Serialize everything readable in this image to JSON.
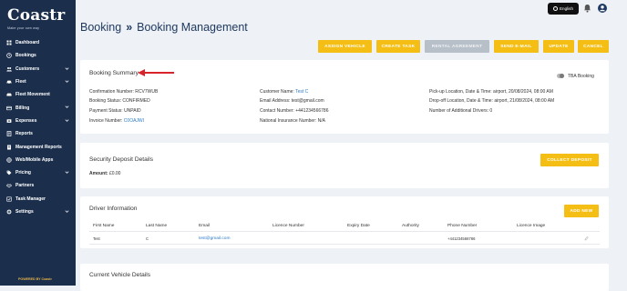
{
  "brand": {
    "name": "Coastr",
    "tagline": "Make your own way",
    "powered": "POWERED BY Coastr"
  },
  "sidebar": {
    "items": [
      {
        "label": "Dashboard",
        "icon": "dashboard-icon",
        "has_children": false
      },
      {
        "label": "Bookings",
        "icon": "bookings-icon",
        "has_children": false
      },
      {
        "label": "Customers",
        "icon": "customers-icon",
        "has_children": true
      },
      {
        "label": "Fleet",
        "icon": "car-icon",
        "has_children": true
      },
      {
        "label": "Fleet Movement",
        "icon": "fleet-movement-icon",
        "has_children": false
      },
      {
        "label": "Billing",
        "icon": "billing-icon",
        "has_children": true
      },
      {
        "label": "Expenses",
        "icon": "expenses-icon",
        "has_children": true
      },
      {
        "label": "Reports",
        "icon": "reports-icon",
        "has_children": false
      },
      {
        "label": "Management Reports",
        "icon": "management-reports-icon",
        "has_children": false
      },
      {
        "label": "Web/Mobile Apps",
        "icon": "apps-icon",
        "has_children": false
      },
      {
        "label": "Pricing",
        "icon": "pricing-icon",
        "has_children": true
      },
      {
        "label": "Partners",
        "icon": "partners-icon",
        "has_children": false
      },
      {
        "label": "Task Manager",
        "icon": "task-manager-icon",
        "has_children": false
      },
      {
        "label": "Settings",
        "icon": "settings-icon",
        "has_children": true
      }
    ]
  },
  "topbar": {
    "language": "English"
  },
  "header": {
    "crumb1": "Booking",
    "separator": "»",
    "crumb2": "Booking Management"
  },
  "actions": {
    "assign_vehicle": "ASSIGN VEHICLE",
    "create_task": "CREATE TASK",
    "rental_agreement": "RENTAL AGREEMENT",
    "send_email": "SEND E-MAIL",
    "update": "UPDATE",
    "cancel": "CANCEL"
  },
  "summary": {
    "title": "Booking Summary",
    "tba_label": "TBA Booking",
    "confirmation_label": "Confirmation Number:",
    "confirmation_value": "RCV7WUB",
    "status_label": "Booking Status:",
    "status_value": "CONFIRMED",
    "payment_label": "Payment Status:",
    "payment_value": "UNPAID",
    "invoice_label": "Invoice Number:",
    "invoice_value": "C0OAJWI",
    "customer_name_label": "Customer Name:",
    "customer_name_value": "Test C",
    "email_label": "Email Address:",
    "email_value": "test@gmail.com",
    "contact_label": "Contact Number:",
    "contact_value": "+441234566786",
    "ni_label": "National Insurance Number:",
    "ni_value": "N/A",
    "pickup_label": "Pick-up Location, Date & Time:",
    "pickup_value": "airport, 20/08/2024, 08:00 AM",
    "dropoff_label": "Drop-off Location, Date & Time:",
    "dropoff_value": "airport, 21/08/2024, 08:00 AM",
    "drivers_label": "Number of Additional Drivers:",
    "drivers_value": "0"
  },
  "deposit": {
    "title": "Security Deposit Details",
    "amount_label": "Amount:",
    "amount_value": "£0.00",
    "collect_button": "COLLECT DEPOSIT"
  },
  "driver": {
    "title": "Driver Information",
    "add_button": "ADD NEW",
    "columns": [
      "First Name",
      "Last Name",
      "Email",
      "Licence Number",
      "Expiry Date",
      "Authority",
      "Phone Number",
      "Licence Image"
    ],
    "rows": [
      {
        "first": "Test",
        "last": "C",
        "email": "test@gmail.com",
        "licence": "",
        "expiry": "",
        "authority": "",
        "phone": "+441234566786",
        "image": ""
      }
    ]
  },
  "vehicle": {
    "title": "Current Vehicle Details"
  },
  "colors": {
    "sidebar": "#1b2f4d",
    "accent": "#f5be14",
    "title": "#1f3a60",
    "link": "#2b7bc8"
  }
}
